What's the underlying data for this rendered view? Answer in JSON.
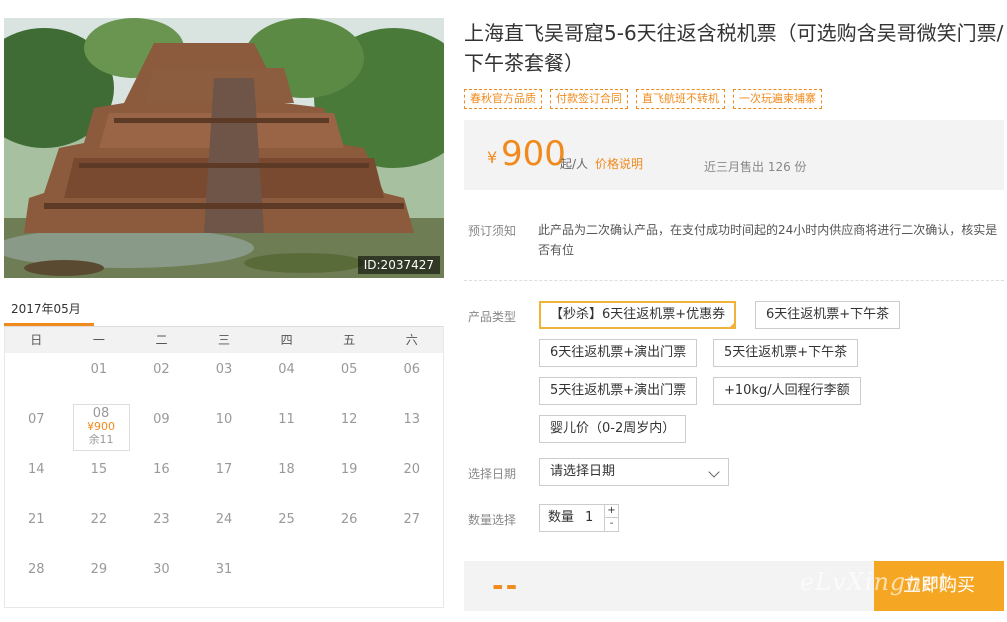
{
  "photo": {
    "id_label": "ID:2037427"
  },
  "calendar": {
    "month": "2017年05月",
    "weekdays": [
      "日",
      "一",
      "二",
      "三",
      "四",
      "五",
      "六"
    ],
    "rows": [
      [
        "",
        "01",
        "02",
        "03",
        "04",
        "05",
        "06"
      ],
      [
        "07",
        "08",
        "09",
        "10",
        "11",
        "12",
        "13"
      ],
      [
        "14",
        "15",
        "16",
        "17",
        "18",
        "19",
        "20"
      ],
      [
        "21",
        "22",
        "23",
        "24",
        "25",
        "26",
        "27"
      ],
      [
        "28",
        "29",
        "30",
        "31",
        "",
        "",
        ""
      ]
    ],
    "selected": {
      "day": "08",
      "price": "¥900",
      "stock": "余11"
    }
  },
  "product": {
    "title": "上海直飞吴哥窟5-6天往返含税机票（可选购含吴哥微笑门票/下午茶套餐）",
    "tags": [
      "春秋官方品质",
      "付款签订合同",
      "直飞航班不转机",
      "一次玩遍柬埔寨"
    ]
  },
  "price": {
    "symbol": "¥",
    "value": "900",
    "unit": "起/人",
    "link": "价格说明",
    "sold": "近三月售出 126 份"
  },
  "booking": {
    "notice_label": "预订须知",
    "notice_text": "此产品为二次确认产品，在支付成功时间起的24小时内供应商将进行二次确认，核实是否有位",
    "type_label": "产品类型",
    "options": [
      "【秒杀】6天往返机票+优惠券",
      "6天往返机票+下午茶",
      "6天往返机票+演出门票",
      "5天往返机票+下午茶",
      "5天往返机票+演出门票",
      "+10kg/人回程行李额",
      "婴儿价（0-2周岁内）"
    ],
    "date_label": "选择日期",
    "date_placeholder": "请选择日期",
    "qty_label": "数量选择",
    "qty_inner_label": "数量",
    "qty_value": "1",
    "qty_plus": "+",
    "qty_minus": "-"
  },
  "footer": {
    "total": "--",
    "buy_label": "立即购买"
  },
  "watermark": "eLvXingnet"
}
